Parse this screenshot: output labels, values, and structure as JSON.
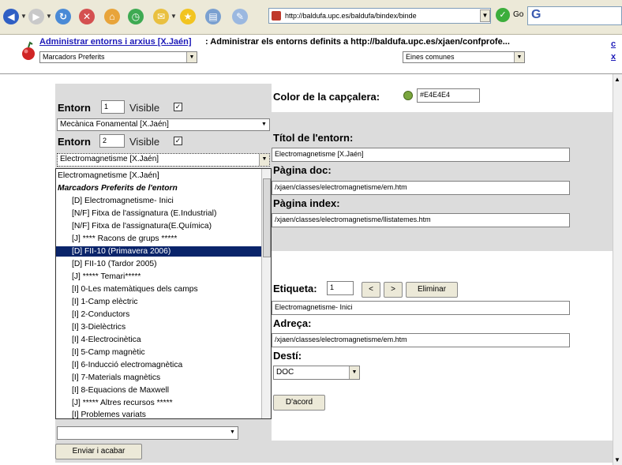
{
  "browser": {
    "address": "http://baldufa.upc.es/baldufa/bindex/binde",
    "go_label": "Go",
    "search_letter": "G"
  },
  "header": {
    "link": "Administrar entorns i arxius [X.Jaén]",
    "text": ": Administrar els entorns definits a http://baldufa.upc.es/xjaen/confprofe...",
    "select_left": "Marcadors Preferits",
    "select_right": "Eines comunes",
    "x1": "c",
    "x2": "x"
  },
  "left": {
    "entorn1_label": "Entorn",
    "entorn1_value": "1",
    "visible1_label": "Visible",
    "select1": "Mecànica Fonamental [X.Jaén]",
    "entorn2_label": "Entorn",
    "entorn2_value": "2",
    "visible2_label": "Visible",
    "select2": "Electromagnetisme [X.Jaén]",
    "bottom_select": "",
    "send_button": "Enviar i acabar"
  },
  "list": {
    "items": [
      "Electromagnetisme [X.Jaén]",
      "Marcadors Preferits de l'entorn",
      "[D] Electromagnetisme- Inici",
      "[N/F] Fitxa de l'assignatura (E.Industrial)",
      "[N/F] Fitxa de l'assignatura(E.Química)",
      "[J] **** Racons de grups *****",
      "[D] FII-10 (Primavera 2006)",
      "[D] FII-10 (Tardor 2005)",
      "[J] ***** Temari*****",
      "[I] 0-Les matemàtiques dels camps",
      "[I] 1-Camp elèctric",
      "[I] 2-Conductors",
      "[I] 3-Dielèctrics",
      "[I] 4-Electrocinètica",
      "[I] 5-Camp magnètic",
      "[I] 6-Inducció electromagnètica",
      "[I] 7-Materials magnètics",
      "[I] 8-Equacions de Maxwell",
      "[J] ***** Altres recursos *****",
      "[I] Problemes variats"
    ]
  },
  "right": {
    "color_label": "Color de la capçalera:",
    "color_value": "#E4E4E4",
    "title_label": "Títol de l'entorn:",
    "title_value": "Electromagnetisme [X.Jaén]",
    "doc_label": "Pàgina doc:",
    "doc_value": "/xjaen/classes/electromagnetisme/em.htm",
    "index_label": "Pàgina index:",
    "index_value": "/xjaen/classes/electromagnetisme/llistatemes.htm",
    "etiqueta_label": "Etiqueta:",
    "etiqueta_value": "1",
    "prev": "<",
    "next": ">",
    "delete": "Eliminar",
    "etiqueta_text": "Electromagnetisme- Inici",
    "adreca_label": "Adreça:",
    "adreca_value": "/xjaen/classes/electromagnetisme/em.htm",
    "desti_label": "Destí:",
    "desti_value": "DOC",
    "ok": "D'acord"
  }
}
